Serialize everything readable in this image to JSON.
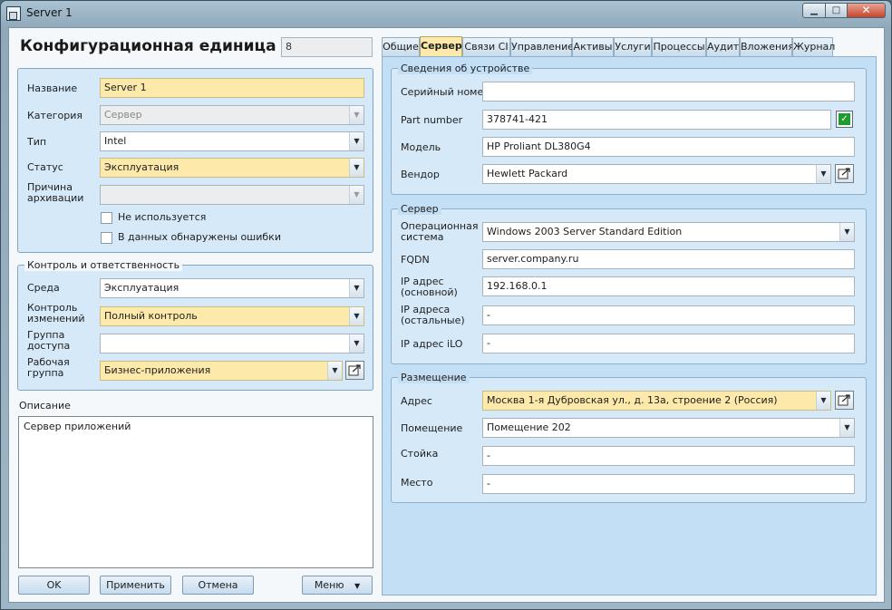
{
  "window": {
    "title": "Server 1",
    "min_glyph": "▁",
    "max_glyph": "□",
    "close_glyph": "✕"
  },
  "header": {
    "title": "Конфигурационная единица",
    "id_value": "8"
  },
  "general": {
    "name_label": "Название",
    "name_value": "Server 1",
    "category_label": "Категория",
    "category_value": "Сервер",
    "type_label": "Тип",
    "type_value": "Intel",
    "status_label": "Статус",
    "status_value": "Эксплуатация",
    "archive_label_1": "Причина",
    "archive_label_2": "архивации",
    "archive_value": "",
    "unused_label": "Не используется",
    "errors_label": "В данных обнаружены ошибки"
  },
  "control": {
    "legend": "Контроль и ответственность",
    "env_label": "Среда",
    "env_value": "Эксплуатация",
    "change_label_1": "Контроль",
    "change_label_2": "изменений",
    "change_value": "Полный контроль",
    "access_label_1": "Группа",
    "access_label_2": "доступа",
    "access_value": "",
    "work_label_1": "Рабочая",
    "work_label_2": "группа",
    "work_value": "Бизнес-приложения"
  },
  "description": {
    "label": "Описание",
    "value": "Сервер приложений"
  },
  "buttons": {
    "ok": "OK",
    "apply": "Применить",
    "cancel": "Отмена",
    "menu": "Меню"
  },
  "tabs": [
    "Общие",
    "Сервер",
    "Связи CI",
    "Управление",
    "Активы",
    "Услуги",
    "Процессы",
    "Аудит",
    "Вложения",
    "Журнал"
  ],
  "active_tab": "Сервер",
  "device": {
    "legend": "Сведения об устройстве",
    "serial_label": "Серийный номер",
    "serial_value": "",
    "part_label": "Part number",
    "part_value": "378741-421",
    "model_label": "Модель",
    "model_value": "HP Proliant DL380G4",
    "vendor_label": "Вендор",
    "vendor_value": "Hewlett Packard"
  },
  "server": {
    "legend": "Сервер",
    "os_label_1": "Операционная",
    "os_label_2": "система",
    "os_value": "Windows 2003 Server Standard Edition",
    "fqdn_label": "FQDN",
    "fqdn_value": "server.company.ru",
    "ip_main_label_1": "IP адрес",
    "ip_main_label_2": "(основной)",
    "ip_main_value": "192.168.0.1",
    "ip_other_label_1": "IP адреса",
    "ip_other_label_2": "(остальные)",
    "ip_other_value": "-",
    "ilo_label": "IP адрес iLO",
    "ilo_value": "-"
  },
  "location": {
    "legend": "Размещение",
    "address_label": "Адрес",
    "address_value": "Москва 1-я Дубровская ул., д. 13а, строение 2 (Россия)",
    "room_label": "Помещение",
    "room_value": "Помещение 202",
    "rack_label": "Стойка",
    "rack_value": "-",
    "place_label": "Место",
    "place_value": "-"
  },
  "glyphs": {
    "dropdown": "▼",
    "check": "✓"
  },
  "colors": {
    "required_field": "#fde9a9",
    "panel": "#d6e9f8",
    "active_tab": "#fde9a9"
  }
}
